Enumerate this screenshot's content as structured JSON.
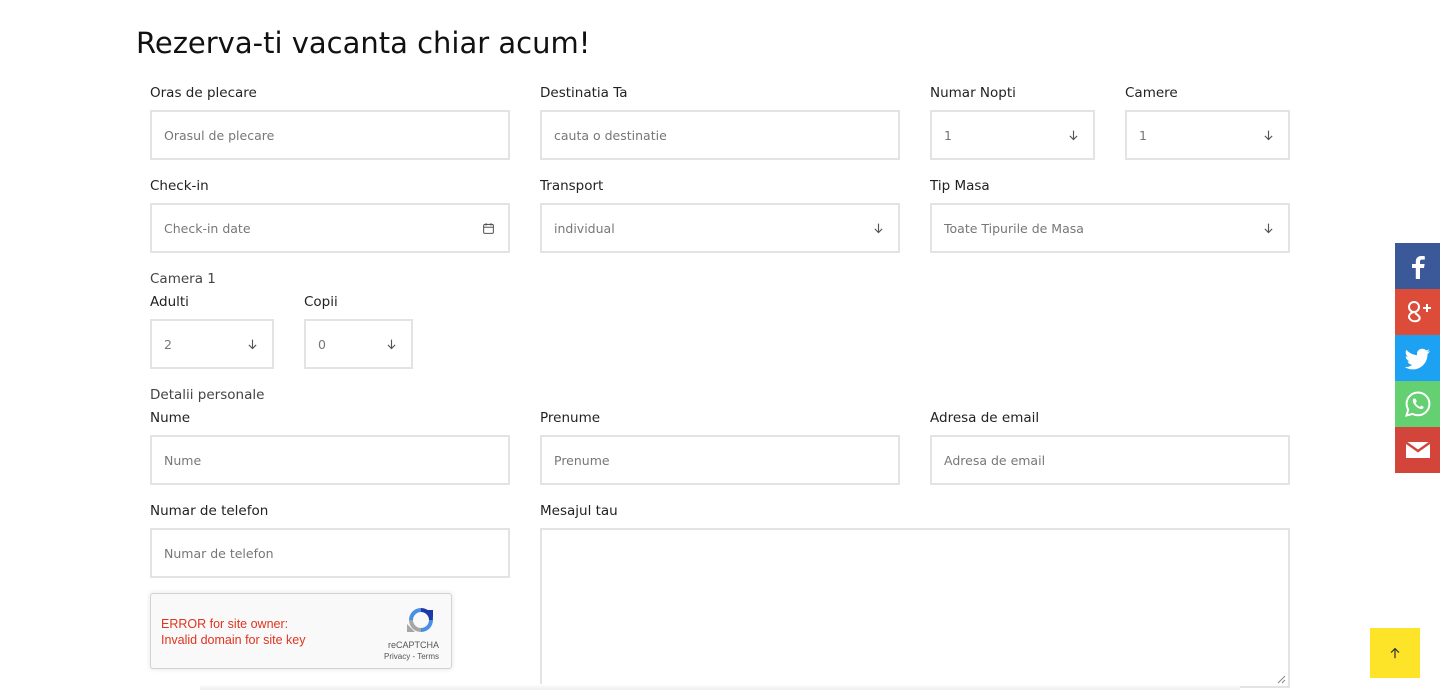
{
  "title": "Rezerva-ti vacanta chiar acum!",
  "fields": {
    "departure": {
      "label": "Oras de plecare",
      "placeholder": "Orasul de plecare"
    },
    "destination": {
      "label": "Destinatia Ta",
      "placeholder": "cauta o destinatie"
    },
    "nights": {
      "label": "Numar Nopti",
      "value": "1"
    },
    "rooms": {
      "label": "Camere",
      "value": "1"
    },
    "checkin": {
      "label": "Check-in",
      "placeholder": "Check-in date"
    },
    "transport": {
      "label": "Transport",
      "value": "individual"
    },
    "meal": {
      "label": "Tip Masa",
      "value": "Toate Tipurile de Masa"
    },
    "room1": {
      "label": "Camera 1"
    },
    "adults": {
      "label": "Adulti",
      "value": "2"
    },
    "children": {
      "label": "Copii",
      "value": "0"
    },
    "personal": {
      "label": "Detalii personale"
    },
    "name": {
      "label": "Nume",
      "placeholder": "Nume"
    },
    "surname": {
      "label": "Prenume",
      "placeholder": "Prenume"
    },
    "email": {
      "label": "Adresa de email",
      "placeholder": "Adresa de email"
    },
    "phone": {
      "label": "Numar de telefon",
      "placeholder": "Numar de telefon"
    },
    "message": {
      "label": "Mesajul tau"
    }
  },
  "captcha": {
    "error_line1": "ERROR for site owner:",
    "error_line2": "Invalid domain for site key",
    "brand": "reCAPTCHA",
    "links": "Privacy - Terms"
  },
  "social": [
    {
      "name": "facebook-icon",
      "color": "#3b5998"
    },
    {
      "name": "google-plus-icon",
      "color": "#dd4b39"
    },
    {
      "name": "twitter-icon",
      "color": "#1da1f2"
    },
    {
      "name": "whatsapp-icon",
      "color": "#65d072"
    },
    {
      "name": "email-icon",
      "color": "#d3443a"
    }
  ],
  "back_to_top": {
    "icon": "arrow-up-icon",
    "color": "#fde428"
  }
}
